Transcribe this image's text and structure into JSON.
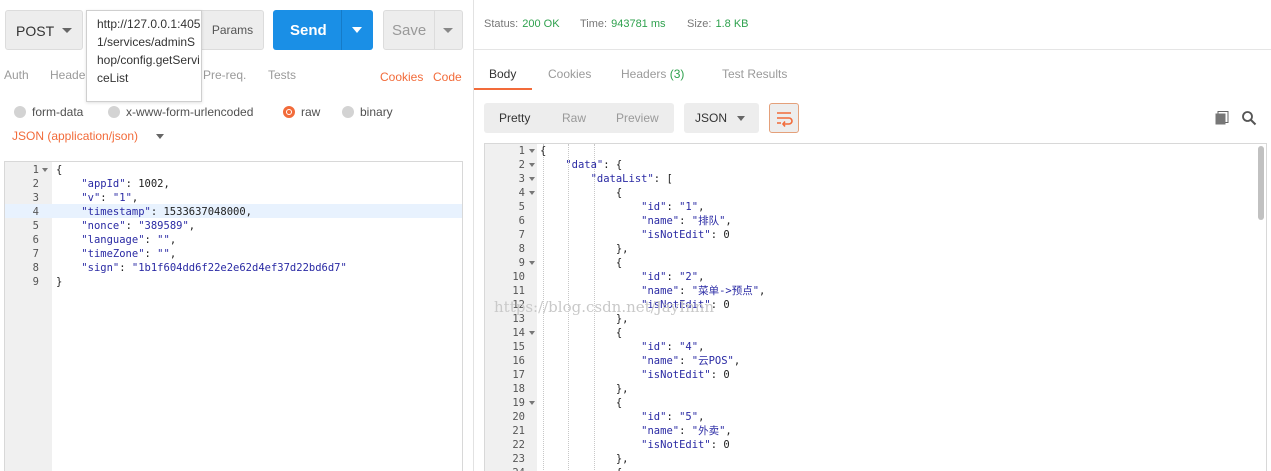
{
  "request": {
    "method": "POST",
    "url": "http://127.0.0.1:4051/services/adminShop/config.getServiceList",
    "params_label": "Params",
    "send_label": "Send",
    "save_label": "Save",
    "tabs": [
      "Auth",
      "Heade",
      "Pre-req.",
      "Tests"
    ],
    "links": {
      "cookies": "Cookies",
      "code": "Code"
    },
    "body_types": [
      "form-data",
      "x-www-form-urlencoded",
      "raw",
      "binary"
    ],
    "selected_body_type": "raw",
    "content_type": "JSON (application/json)",
    "body_lines": [
      "{",
      "    \"appId\": 1002,",
      "    \"v\": \"1\",",
      "    \"timestamp\": 1533637048000,",
      "    \"nonce\": \"389589\",",
      "    \"language\": \"\",",
      "    \"timeZone\": \"\",",
      "    \"sign\": \"1b1f604dd6f22e2e62d4ef37d22bd6d7\"",
      "}"
    ],
    "active_line": 4
  },
  "response": {
    "status_label": "Status:",
    "status_value": "200 OK",
    "time_label": "Time:",
    "time_value": "943781 ms",
    "size_label": "Size:",
    "size_value": "1.8 KB",
    "tabs": {
      "body": "Body",
      "cookies": "Cookies",
      "headers": "Headers",
      "headers_count": "(3)",
      "test_results": "Test Results"
    },
    "view_modes": [
      "Pretty",
      "Raw",
      "Preview"
    ],
    "format": "JSON",
    "body_lines": [
      "{",
      "    \"data\": {",
      "        \"dataList\": [",
      "            {",
      "                \"id\": \"1\",",
      "                \"name\": \"排队\",",
      "                \"isNotEdit\": 0",
      "            },",
      "            {",
      "                \"id\": \"2\",",
      "                \"name\": \"菜单->预点\",",
      "                \"isNotEdit\": 0",
      "            },",
      "            {",
      "                \"id\": \"4\",",
      "                \"name\": \"云POS\",",
      "                \"isNotEdit\": 0",
      "            },",
      "            {",
      "                \"id\": \"5\",",
      "                \"name\": \"外卖\",",
      "                \"isNotEdit\": 0",
      "            },",
      "            {"
    ],
    "fold_lines": [
      1,
      2,
      3,
      4,
      9,
      14,
      19
    ]
  },
  "watermark": "https://blog.csdn.net/JayInnn",
  "colors": {
    "accent": "#f26b3a",
    "send": "#1a8fe6",
    "status_green": "#2fa14e"
  }
}
